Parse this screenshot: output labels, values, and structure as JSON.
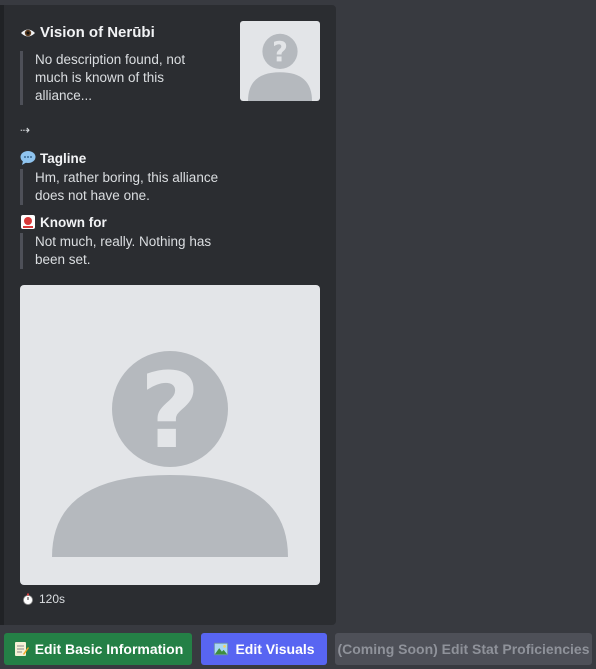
{
  "embed": {
    "title": "Vision of Nerūbi",
    "title_icon": "eye-icon",
    "description": "No description found, not much is known of this alliance...",
    "separator": "⇢",
    "fields": [
      {
        "icon": "speech-bubble-icon",
        "name": "Tagline",
        "value": "Hm, rather boring, this alliance does not have one."
      },
      {
        "icon": "red-badge-icon",
        "name": "Known for",
        "value": "Not much, really. Nothing has been set."
      }
    ],
    "thumbnail": "placeholder-avatar",
    "image": "placeholder-avatar",
    "footer_icon": "stopwatch-icon",
    "footer_text": "120s"
  },
  "buttons": {
    "edit_basic": {
      "label": "Edit Basic Information",
      "icon": "memo-icon",
      "color": "#248046"
    },
    "edit_visuals": {
      "label": "Edit Visuals",
      "icon": "picture-icon",
      "color": "#5865f2"
    },
    "edit_stats": {
      "label": "(Coming Soon) Edit Stat Proficiencies",
      "color": "#4e5058",
      "disabled": true
    }
  },
  "colors": {
    "background": "#383a40",
    "embed_bg": "#2b2d31",
    "placeholder_bg": "#e3e5e8",
    "placeholder_fg": "#b5b9be"
  }
}
